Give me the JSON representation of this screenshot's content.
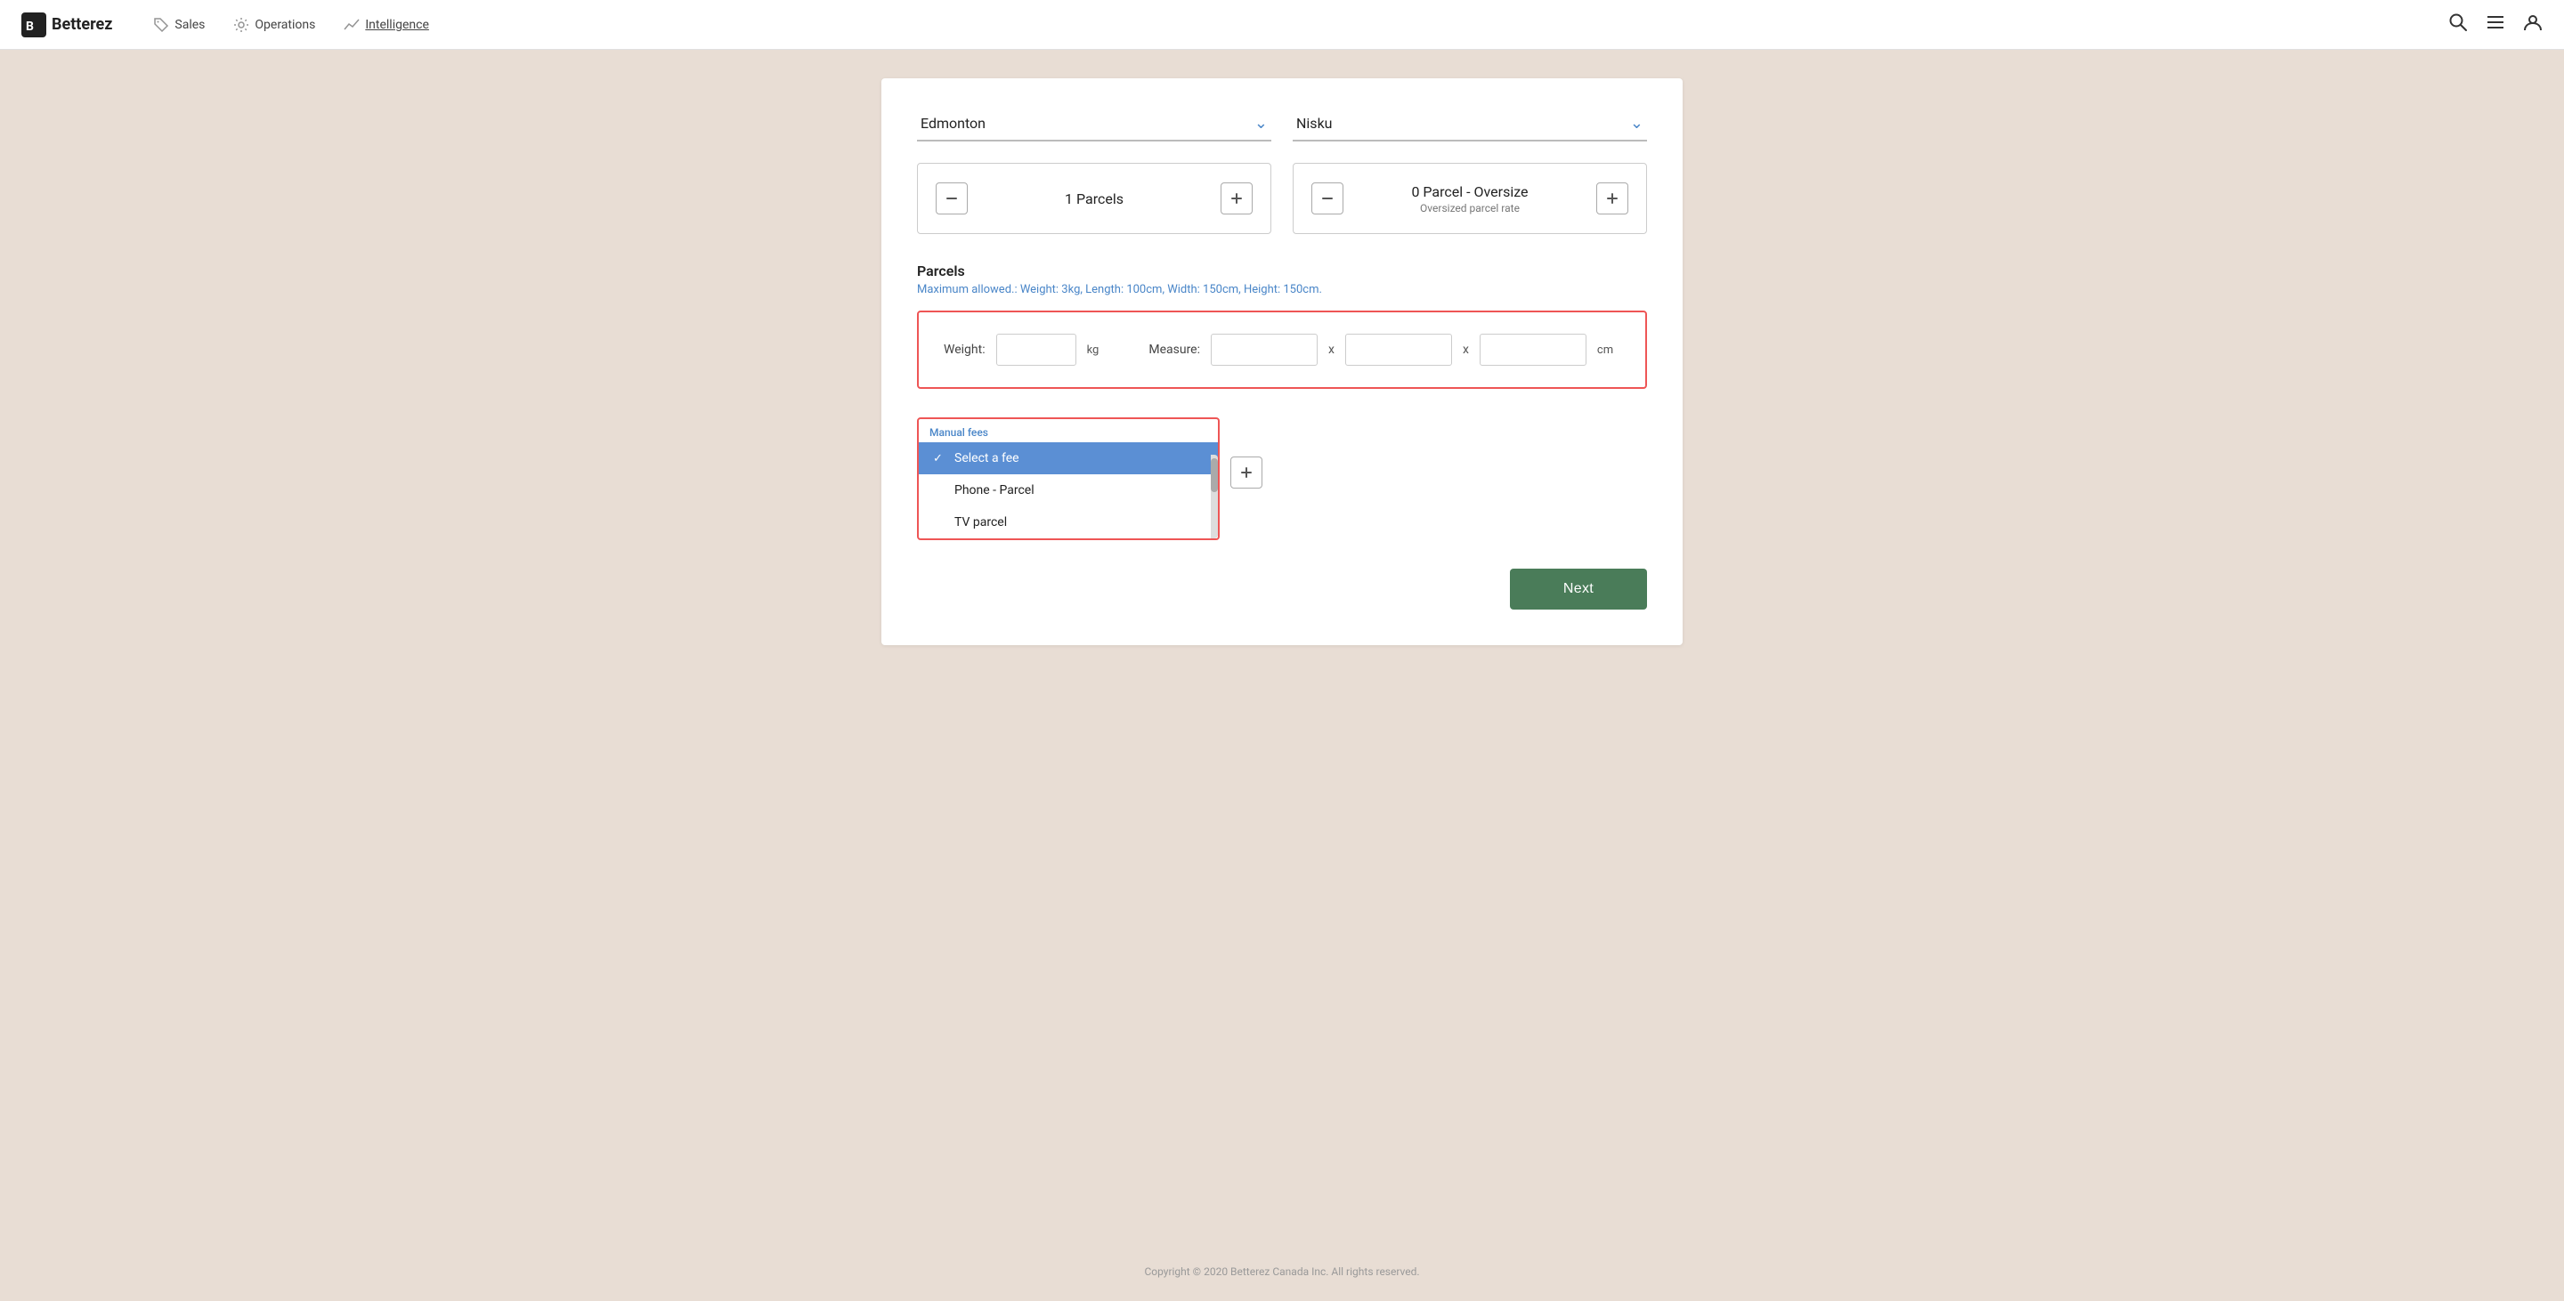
{
  "header": {
    "logo_text": "Betterez",
    "nav": [
      {
        "id": "sales",
        "label": "Sales",
        "icon": "tag"
      },
      {
        "id": "operations",
        "label": "Operations",
        "icon": "gear"
      },
      {
        "id": "intelligence",
        "label": "Intelligence",
        "icon": "chart"
      }
    ],
    "actions": [
      "search",
      "menu",
      "user"
    ]
  },
  "locations": {
    "from": "Edmonton",
    "to": "Nisku"
  },
  "parcel_counters": {
    "regular": {
      "count": "1",
      "label": "Parcels"
    },
    "oversize": {
      "count": "0",
      "label": "Parcel - Oversize",
      "subtitle": "Oversized parcel rate"
    }
  },
  "parcels_section": {
    "title": "Parcels",
    "hint": "Maximum allowed.: Weight: 3kg, Length: 100cm, Width: 150cm, Height: 150cm.",
    "weight_label": "Weight:",
    "weight_unit": "kg",
    "measure_label": "Measure:",
    "measure_unit": "cm",
    "x_separator": "x"
  },
  "manual_fees": {
    "label": "Manual fees",
    "options": [
      {
        "id": "select-fee",
        "label": "Select a fee",
        "selected": true
      },
      {
        "id": "phone-parcel",
        "label": "Phone - Parcel",
        "selected": false
      },
      {
        "id": "tv-parcel",
        "label": "TV parcel",
        "selected": false
      }
    ]
  },
  "buttons": {
    "next": "Next",
    "add": "+"
  },
  "footer": {
    "copyright": "Copyright © 2020 Betterez Canada Inc. All rights reserved."
  }
}
